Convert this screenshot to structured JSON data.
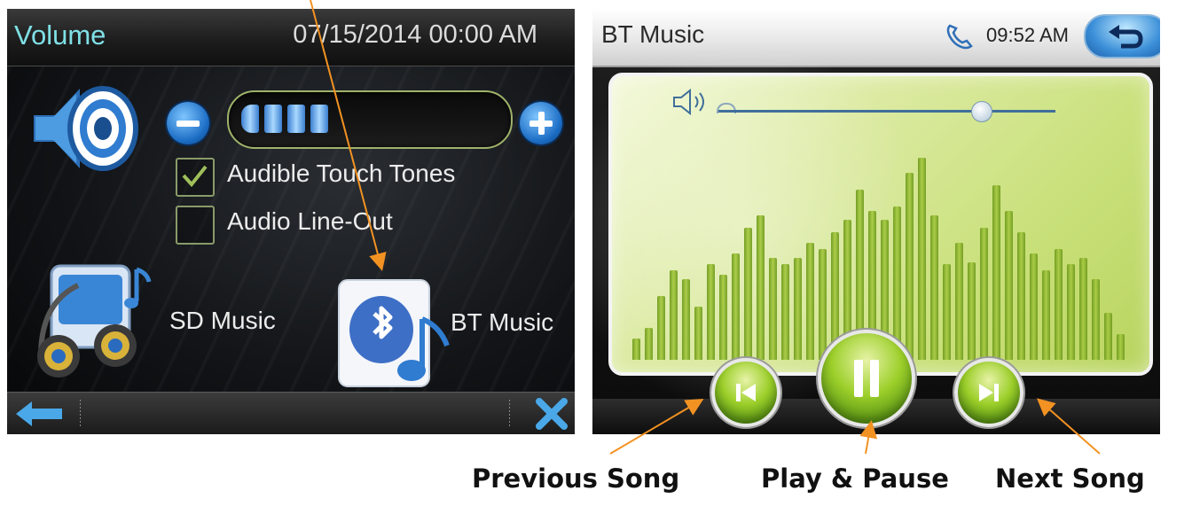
{
  "left_screen": {
    "title": "Volume",
    "datetime": "07/15/2014 00:00 AM",
    "volume": {
      "filled_segments": 4,
      "total_segments": 12
    },
    "options": [
      {
        "label": "Audible Touch Tones",
        "checked": true
      },
      {
        "label": "Audio Line-Out",
        "checked": false
      }
    ],
    "apps": {
      "sd_label": "SD Music",
      "bt_label": "BT Music"
    },
    "footer": {
      "back_icon": "left-arrow-icon",
      "close_icon": "close-icon"
    }
  },
  "right_screen": {
    "title": "BT Music",
    "time": "09:52 AM",
    "volume_fraction": 0.78,
    "equalizer_levels": [
      0.1,
      0.15,
      0.3,
      0.42,
      0.38,
      0.25,
      0.45,
      0.4,
      0.5,
      0.62,
      0.68,
      0.48,
      0.45,
      0.48,
      0.55,
      0.52,
      0.6,
      0.66,
      0.8,
      0.7,
      0.66,
      0.72,
      0.88,
      0.95,
      0.68,
      0.45,
      0.55,
      0.46,
      0.62,
      0.82,
      0.7,
      0.6,
      0.5,
      0.42,
      0.52,
      0.45,
      0.48,
      0.38,
      0.22,
      0.12
    ],
    "colors": {
      "accent_green": "#9ccf2a",
      "header_blue": "#3b8fd8"
    }
  },
  "annotations": {
    "previous": "Previous Song",
    "play_pause": "Play & Pause",
    "next": "Next Song"
  }
}
